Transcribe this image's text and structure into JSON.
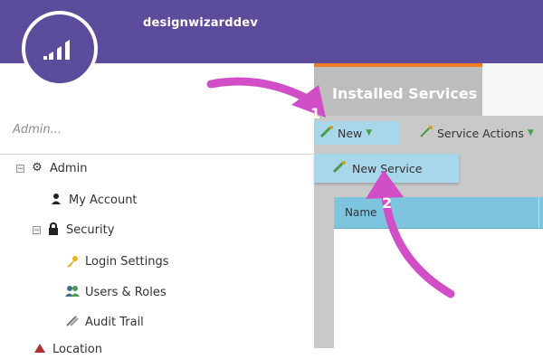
{
  "header": {
    "brand": "designwizarddev"
  },
  "sidebar": {
    "search_placeholder": "Admin...",
    "items": [
      {
        "label": "Admin",
        "icon": "gear-icon",
        "expander": "minus"
      },
      {
        "label": "My Account",
        "icon": "person-icon"
      },
      {
        "label": "Security",
        "icon": "lock-icon",
        "expander": "minus"
      },
      {
        "label": "Login Settings",
        "icon": "key-icon"
      },
      {
        "label": "Users & Roles",
        "icon": "users-icon"
      },
      {
        "label": "Audit Trail",
        "icon": "audit-icon"
      },
      {
        "label": "Location",
        "icon": "location-icon"
      }
    ]
  },
  "main": {
    "tabs": [
      {
        "label": "Installed Services"
      },
      {
        "label": ""
      }
    ],
    "toolbar": {
      "new_label": "New",
      "actions_label": "Service Actions"
    },
    "dropdown": {
      "item_label": "New Service"
    },
    "grid": {
      "columns": [
        "Name"
      ]
    }
  },
  "annotations": {
    "step1": "1",
    "step2": "2"
  },
  "colors": {
    "header": "#5b4d9c",
    "tab_accent": "#ee7c22",
    "highlight": "#a8d6ea",
    "grid_header": "#7dc4df",
    "arrow": "#d24ec6"
  }
}
